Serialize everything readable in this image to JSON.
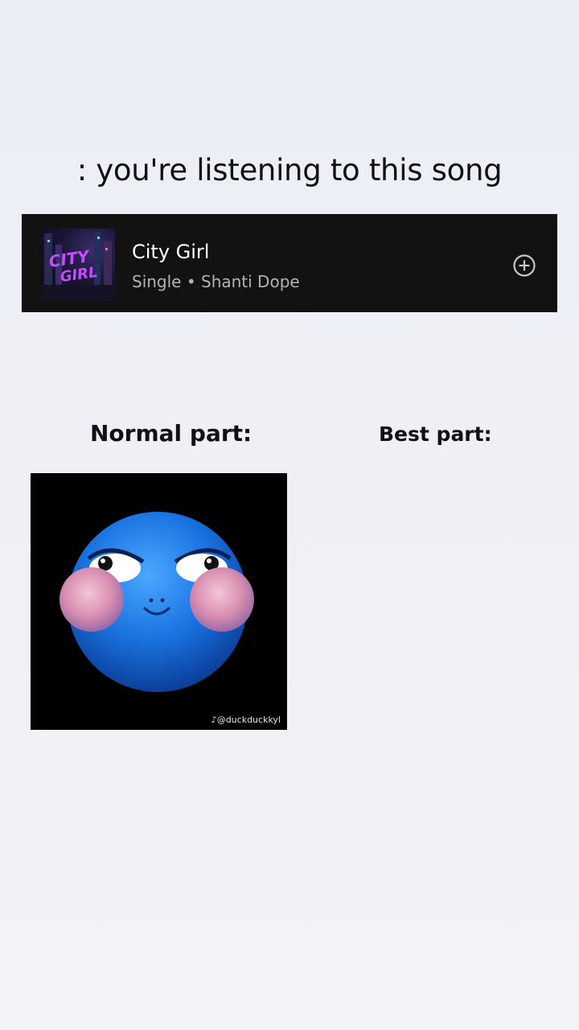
{
  "headline": ": you're listening to this song",
  "song": {
    "title": "City Girl",
    "subtitle": "Single • Shanti Dope",
    "cover_text": "CITY GIRL",
    "add_icon": "plus-circle-icon"
  },
  "sections": {
    "normal_label": "Normal part:",
    "best_label": "Best part:"
  },
  "meme": {
    "watermark": "@duckduckkyl",
    "image": "blue blushing smiley emoji"
  },
  "colors": {
    "card_bg": "#121212",
    "subtitle": "#b3b3b3",
    "emoji_blue": "#1f7fe0"
  }
}
